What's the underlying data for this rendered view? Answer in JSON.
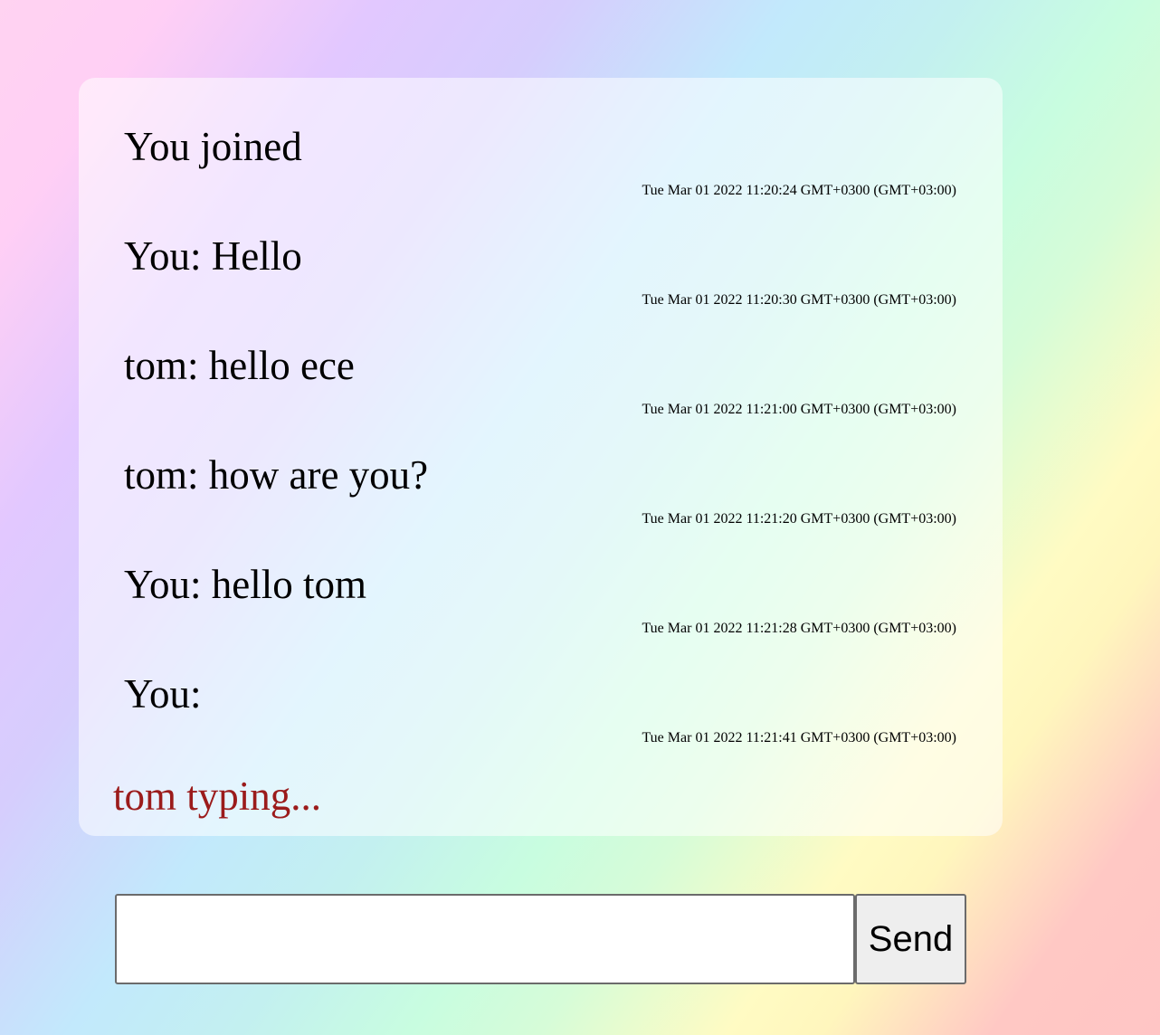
{
  "messages": [
    {
      "text": "You joined",
      "time": "Tue Mar 01 2022 11:20:24 GMT+0300 (GMT+03:00)"
    },
    {
      "text": "You: Hello",
      "time": "Tue Mar 01 2022 11:20:30 GMT+0300 (GMT+03:00)"
    },
    {
      "text": "tom: hello ece",
      "time": "Tue Mar 01 2022 11:21:00 GMT+0300 (GMT+03:00)"
    },
    {
      "text": "tom: how are you?",
      "time": "Tue Mar 01 2022 11:21:20 GMT+0300 (GMT+03:00)"
    },
    {
      "text": "You: hello tom",
      "time": "Tue Mar 01 2022 11:21:28 GMT+0300 (GMT+03:00)"
    },
    {
      "text": "You:",
      "time": "Tue Mar 01 2022 11:21:41 GMT+0300 (GMT+03:00)"
    }
  ],
  "typing_indicator": "tom typing...",
  "compose": {
    "input_value": "",
    "send_label": "Send"
  },
  "colors": {
    "typing_text": "#9b1b1b",
    "panel_background": "rgba(255,255,255,0.55)",
    "button_background": "#eeeeee"
  }
}
